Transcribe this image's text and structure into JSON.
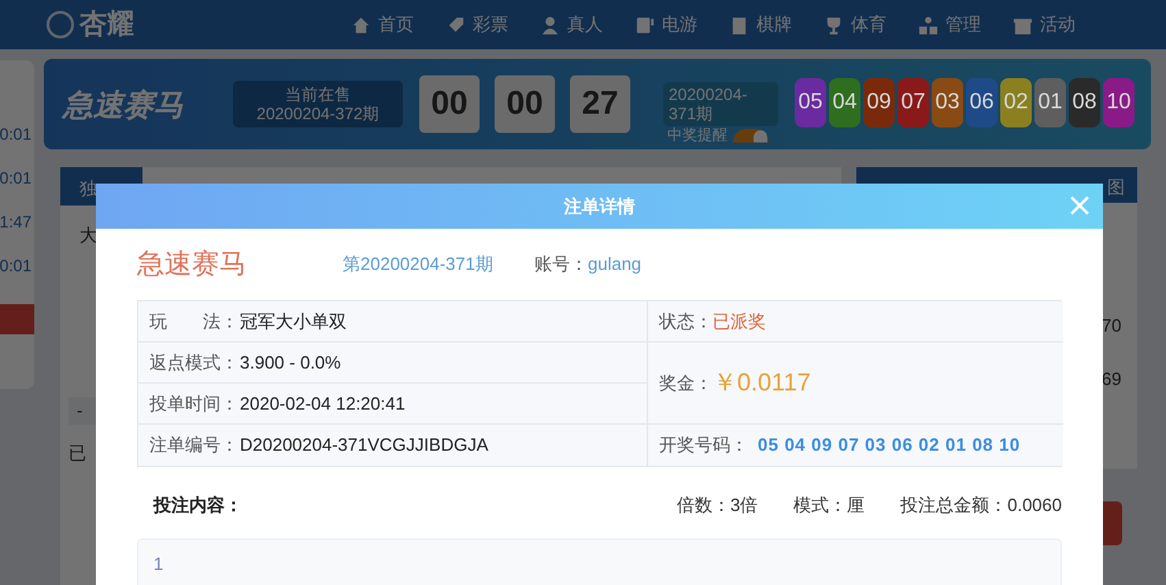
{
  "nav": {
    "logo": "杏耀",
    "items": [
      {
        "label": "首页"
      },
      {
        "label": "彩票"
      },
      {
        "label": "真人"
      },
      {
        "label": "电游"
      },
      {
        "label": "棋牌"
      },
      {
        "label": "体育"
      },
      {
        "label": "管理"
      },
      {
        "label": "活动"
      }
    ]
  },
  "side_times": [
    "0:01",
    "0:01",
    "1:47",
    "0:01"
  ],
  "game_header": {
    "logo": "急速赛马",
    "current_label": "当前在售",
    "current_period": "20200204-372期",
    "countdown": [
      "00",
      "00",
      "27"
    ],
    "last_period": "20200204-371期",
    "win_alert_label": "中奖提醒",
    "win_alert_on": true,
    "balls": [
      {
        "number": "05",
        "color": "#6a2aa0"
      },
      {
        "number": "04",
        "color": "#2e6e1e"
      },
      {
        "number": "09",
        "color": "#7a2a0a"
      },
      {
        "number": "07",
        "color": "#8a1a1a"
      },
      {
        "number": "03",
        "color": "#8a4a14"
      },
      {
        "number": "06",
        "color": "#1e4a88"
      },
      {
        "number": "02",
        "color": "#8a8020"
      },
      {
        "number": "01",
        "color": "#5e5e5e"
      },
      {
        "number": "08",
        "color": "#2a2a2a"
      },
      {
        "number": "10",
        "color": "#8a1a88"
      }
    ]
  },
  "background_texts": {
    "tab": "独",
    "row": "大",
    "selected": "已",
    "minus": "-",
    "value_1": "70",
    "value_2": "69",
    "trend": "图"
  },
  "modal": {
    "title": "注单详情",
    "game": "急速赛马",
    "period": "第20200204-371期",
    "account_label": "账号：",
    "account": "gulang",
    "rows": [
      {
        "label": "玩　　法：",
        "value": "冠军大小单双"
      },
      {
        "label": "返点模式：",
        "value": "3.900 - 0.0%"
      },
      {
        "label": "投单时间：",
        "value": "2020-02-04 12:20:41"
      },
      {
        "label": "注单编号：",
        "value": "D20200204-371VCGJJIBDGJA"
      }
    ],
    "status_label": "状态：",
    "status": "已派奖",
    "prize_label": "奖金：",
    "prize": "￥0.0117",
    "draw_label": "开奖号码：",
    "draw_numbers": "05 04 09 07 03 06 02 01 08 10",
    "content_label": "投注内容：",
    "multiple": "倍数：3倍",
    "mode": "模式：厘",
    "total": "投注总金额：0.0060",
    "content": "1"
  }
}
